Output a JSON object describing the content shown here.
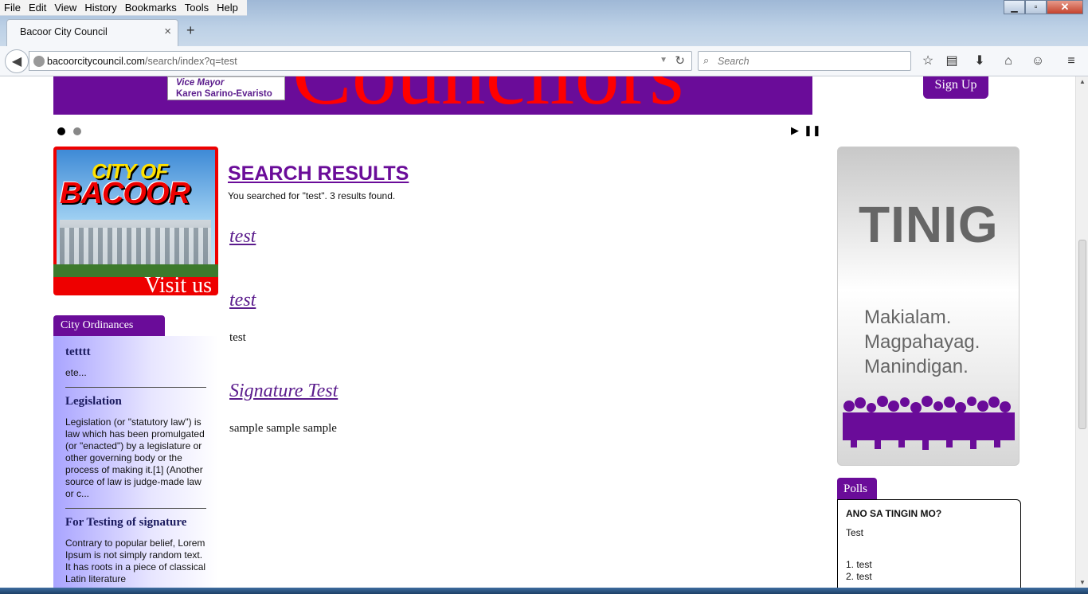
{
  "menu": [
    "File",
    "Edit",
    "View",
    "History",
    "Bookmarks",
    "Tools",
    "Help"
  ],
  "tab": {
    "title": "Bacoor City Council"
  },
  "url": {
    "host": "bacoorcitycouncil.com",
    "path": "/search/index?q=test"
  },
  "search": {
    "placeholder": "Search"
  },
  "banner": {
    "heading_fragment": "Councilors",
    "vice_mayor_title": "Vice Mayor",
    "vice_mayor_name": "Karen Sarino-Evaristo"
  },
  "signup": {
    "label": "Sign Up"
  },
  "visit_banner": {
    "line1": "CITY OF",
    "line2": "BACOOR",
    "caption": "Visit us"
  },
  "ordinances": {
    "tab_label": "City Ordinances",
    "items": [
      {
        "heading": "tetttt",
        "body": "ete..."
      },
      {
        "heading": "Legislation",
        "body": "Legislation (or \"statutory law\") is law which has been promulgated (or \"enacted\") by a legislature or other governing body or the process of making it.[1] (Another source of law is judge-made law or c..."
      },
      {
        "heading": "For Testing of signature",
        "body": "Contrary to popular belief, Lorem Ipsum is not simply random text. It has roots in a piece of classical Latin literature"
      }
    ]
  },
  "results": {
    "title": "SEARCH RESULTS",
    "summary": "You searched for \"test\". 3 results found.",
    "items": [
      {
        "title": "test",
        "snippet": ""
      },
      {
        "title": "test",
        "snippet": "test"
      },
      {
        "title": "Signature Test",
        "snippet": "sample sample sample"
      }
    ]
  },
  "tinig": {
    "word": "TINIG",
    "slogan1": "Makialam.",
    "slogan2": "Magpahayag.",
    "slogan3": "Manindigan."
  },
  "polls": {
    "tab_label": "Polls",
    "question": "ANO SA TINGIN MO?",
    "description": "Test",
    "options": [
      "1. test",
      "2. test"
    ]
  },
  "colors": {
    "brand_purple": "#6a0c99",
    "banner_red": "#ff0000"
  }
}
